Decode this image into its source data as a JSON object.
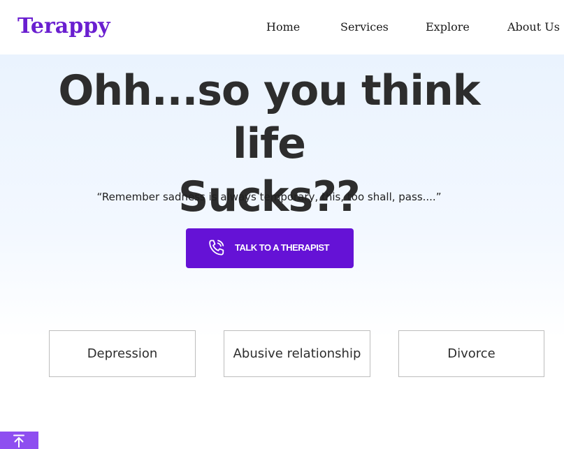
{
  "brand": {
    "logo": "Terappy",
    "color": "#6a1fd0"
  },
  "nav": {
    "items": [
      "Home",
      "Services",
      "Explore",
      "About Us"
    ]
  },
  "hero": {
    "headline_line1": "Ohh...so you think life",
    "headline_line2": "Sucks??",
    "quote": "“Remember sadness is always temporary, this, too shall, pass....”",
    "cta_label": "TALK TO A THERAPIST",
    "cta_icon": "phone-call-icon",
    "cta_color": "#6512d6"
  },
  "topics": {
    "items": [
      "Depression",
      "Abusive relationship",
      "Divorce"
    ]
  },
  "scroll_top": {
    "icon": "arrow-up-to-top-icon",
    "color": "#8e4ef0"
  }
}
